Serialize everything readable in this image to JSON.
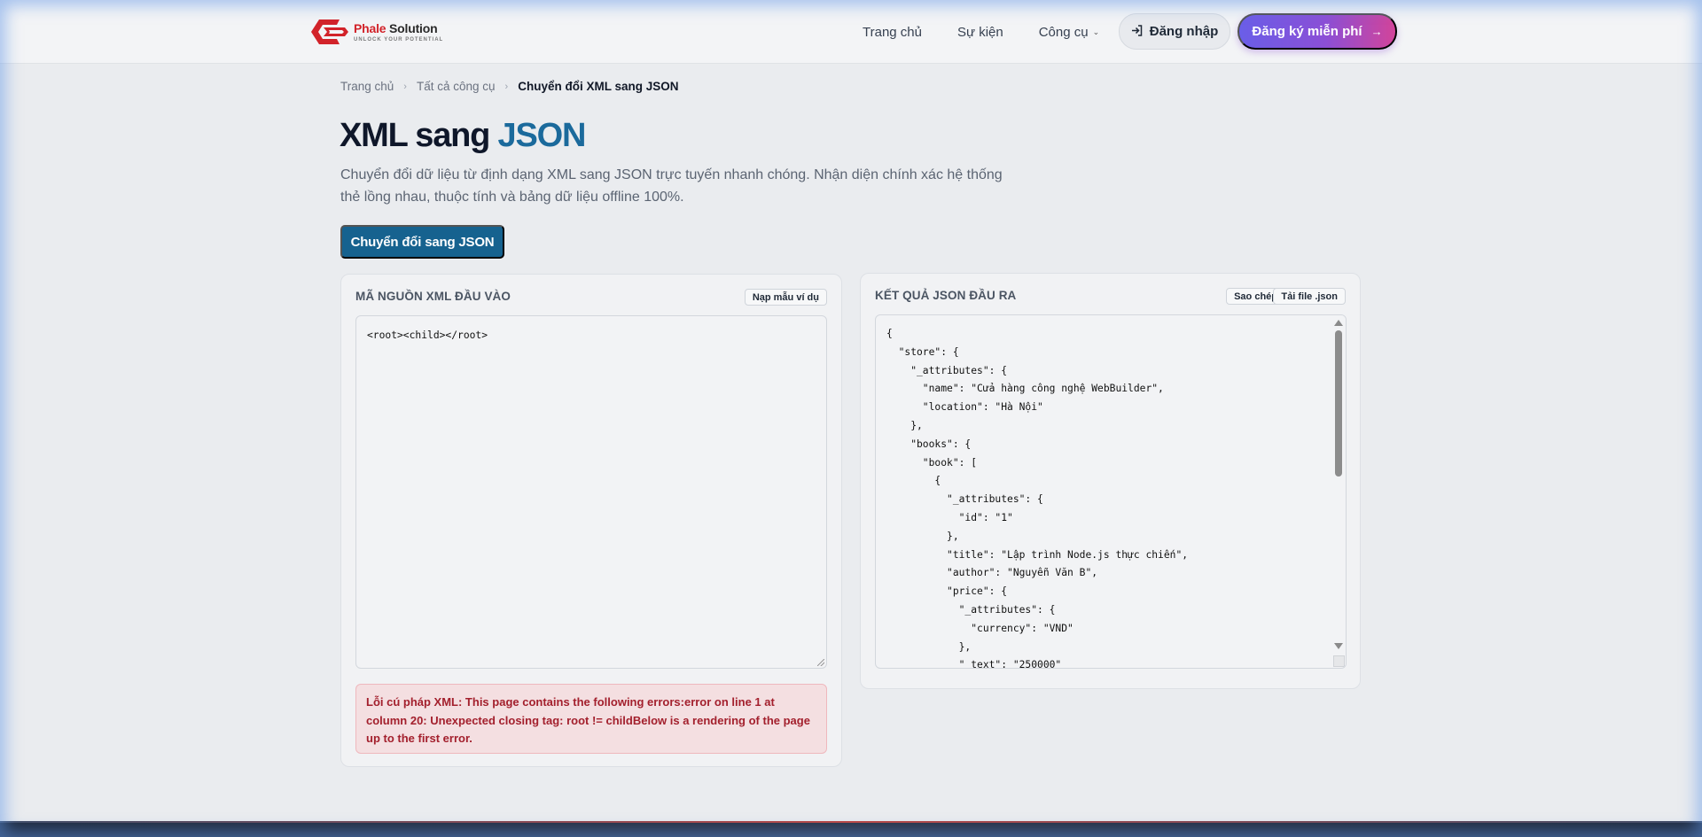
{
  "brand": {
    "name_part1": "Phale",
    "name_part2": " Solution",
    "tagline": "UNLOCK YOUR POTENTIAL",
    "primary_color": "#d2232a"
  },
  "nav": {
    "items": [
      {
        "label": "Trang chủ"
      },
      {
        "label": "Sự kiện"
      },
      {
        "label": "Công cụ",
        "has_dropdown": true
      }
    ],
    "login_label": "Đăng nhập",
    "signup_label": "Đăng ký miễn phí"
  },
  "breadcrumb": {
    "items": [
      "Trang chủ",
      "Tất cả công cụ"
    ],
    "current": "Chuyển đổi XML sang JSON"
  },
  "page": {
    "title_main": "XML sang ",
    "title_accent": "JSON",
    "accent_color": "#1b6a9c",
    "description": "Chuyển đổi dữ liệu từ định dạng XML sang JSON trực tuyến nhanh chóng. Nhận diện chính xác hệ thống thẻ lồng nhau, thuộc tính và bảng dữ liệu offline 100%.",
    "convert_button": "Chuyển đổi sang JSON"
  },
  "input_panel": {
    "title": "Mã nguồn XML đầu vào",
    "load_sample_button": "Nạp mẫu ví dụ",
    "xml_value": "<root><child></root>",
    "error_message": "Lỗi cú pháp XML: This page contains the following errors:error on line 1 at column 20: Unexpected closing tag: root != childBelow is a rendering of the page up to the first error."
  },
  "output_panel": {
    "title": "Kết quả JSON đầu ra",
    "copy_button": "Sao chép",
    "download_button": "Tải file .json",
    "json_lines": [
      "{",
      "  \"store\": {",
      "    \"_attributes\": {",
      "      \"name\": \"Cửa hàng công nghệ WebBuilder\",",
      "      \"location\": \"Hà Nội\"",
      "    },",
      "    \"books\": {",
      "      \"book\": [",
      "        {",
      "          \"_attributes\": {",
      "            \"id\": \"1\"",
      "          },",
      "          \"title\": \"Lập trình Node.js thực chiến\",",
      "          \"author\": \"Nguyễn Văn B\",",
      "          \"price\": {",
      "            \"_attributes\": {",
      "              \"currency\": \"VND\"",
      "            },",
      "            \"_text\": \"250000\""
    ]
  }
}
